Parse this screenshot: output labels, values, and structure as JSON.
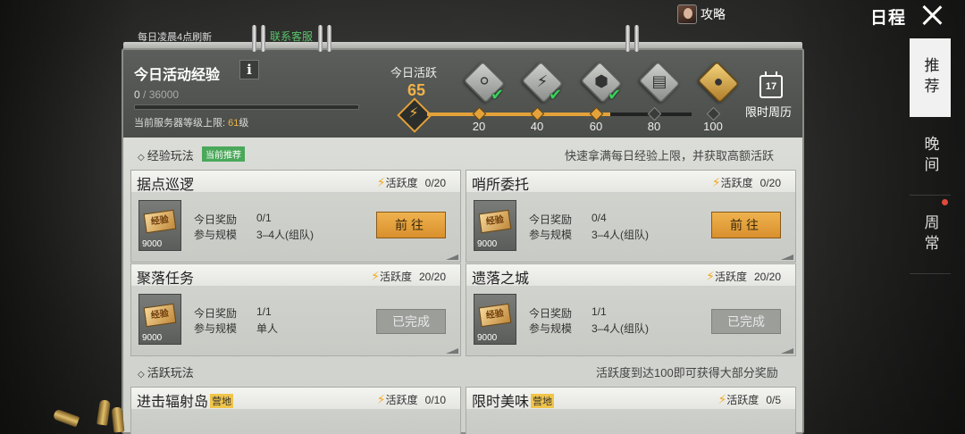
{
  "header": {
    "user_label": "攻略",
    "page_title": "日程"
  },
  "side_tabs": [
    {
      "label": "推荐",
      "active": true,
      "dot": false
    },
    {
      "label": "晚间",
      "active": false,
      "dot": false
    },
    {
      "label": "周常",
      "active": false,
      "dot": true
    }
  ],
  "notes": {
    "refresh": "每日凌晨4点刷新",
    "contact": "联系客服"
  },
  "exp": {
    "title": "今日活动经验",
    "info_label": "i",
    "current": "0",
    "max": "36000",
    "progress": 0,
    "server_cap_prefix": "当前服务器等级上限: ",
    "server_cap_level": "61",
    "server_cap_suffix": "级"
  },
  "activity": {
    "label": "今日活跃",
    "value": "65",
    "progress": 65,
    "milestones": [
      {
        "value": "20",
        "claimed": true,
        "chest": "silver",
        "icon": "coin-chest-icon"
      },
      {
        "value": "40",
        "claimed": true,
        "chest": "silver",
        "icon": "bolt-chest-icon"
      },
      {
        "value": "60",
        "claimed": true,
        "chest": "silver",
        "icon": "emblem-chest-icon"
      },
      {
        "value": "80",
        "claimed": false,
        "chest": "silver",
        "icon": "crate-chest-icon"
      },
      {
        "value": "100",
        "claimed": false,
        "chest": "gold",
        "icon": "gold-coin-chest-icon"
      }
    ],
    "weekly_label": "限时周历",
    "calendar_day": "17"
  },
  "exp_section": {
    "title": "经验玩法",
    "tag": "当前推荐",
    "desc": "快速拿满每日经验上限，并获取高额活跃"
  },
  "cards": [
    {
      "name": "据点巡逻",
      "act_label": "活跃度",
      "act_score": "0/20",
      "reward_amt": "9000",
      "reward_label": "经验",
      "today_label": "今日奖励",
      "today_value": "0/1",
      "scale_label": "参与规模",
      "scale_value": "3–4人(组队)",
      "button": "前往",
      "done": false
    },
    {
      "name": "哨所委托",
      "act_label": "活跃度",
      "act_score": "0/20",
      "reward_amt": "9000",
      "reward_label": "经验",
      "today_label": "今日奖励",
      "today_value": "0/4",
      "scale_label": "参与规模",
      "scale_value": "3–4人(组队)",
      "button": "前往",
      "done": false
    },
    {
      "name": "聚落任务",
      "act_label": "活跃度",
      "act_score": "20/20",
      "reward_amt": "9000",
      "reward_label": "经验",
      "today_label": "今日奖励",
      "today_value": "1/1",
      "scale_label": "参与规模",
      "scale_value": "单人",
      "button": "已完成",
      "done": true
    },
    {
      "name": "遗落之城",
      "act_label": "活跃度",
      "act_score": "20/20",
      "reward_amt": "9000",
      "reward_label": "经验",
      "today_label": "今日奖励",
      "today_value": "1/1",
      "scale_label": "参与规模",
      "scale_value": "3–4人(组队)",
      "button": "已完成",
      "done": true
    }
  ],
  "active_section": {
    "title": "活跃玩法",
    "desc": "活跃度到达100即可获得大部分奖励"
  },
  "partial_cards": [
    {
      "name": "进击辐射岛",
      "tag": "营地",
      "act_label": "活跃度",
      "act_score": "0/10"
    },
    {
      "name": "限时美味",
      "tag": "营地",
      "act_label": "活跃度",
      "act_score": "0/5"
    }
  ],
  "colors": {
    "accent": "#e4a23a",
    "check": "#39d15a",
    "recommend_tag": "#4aa85a",
    "link": "#58c46a"
  }
}
